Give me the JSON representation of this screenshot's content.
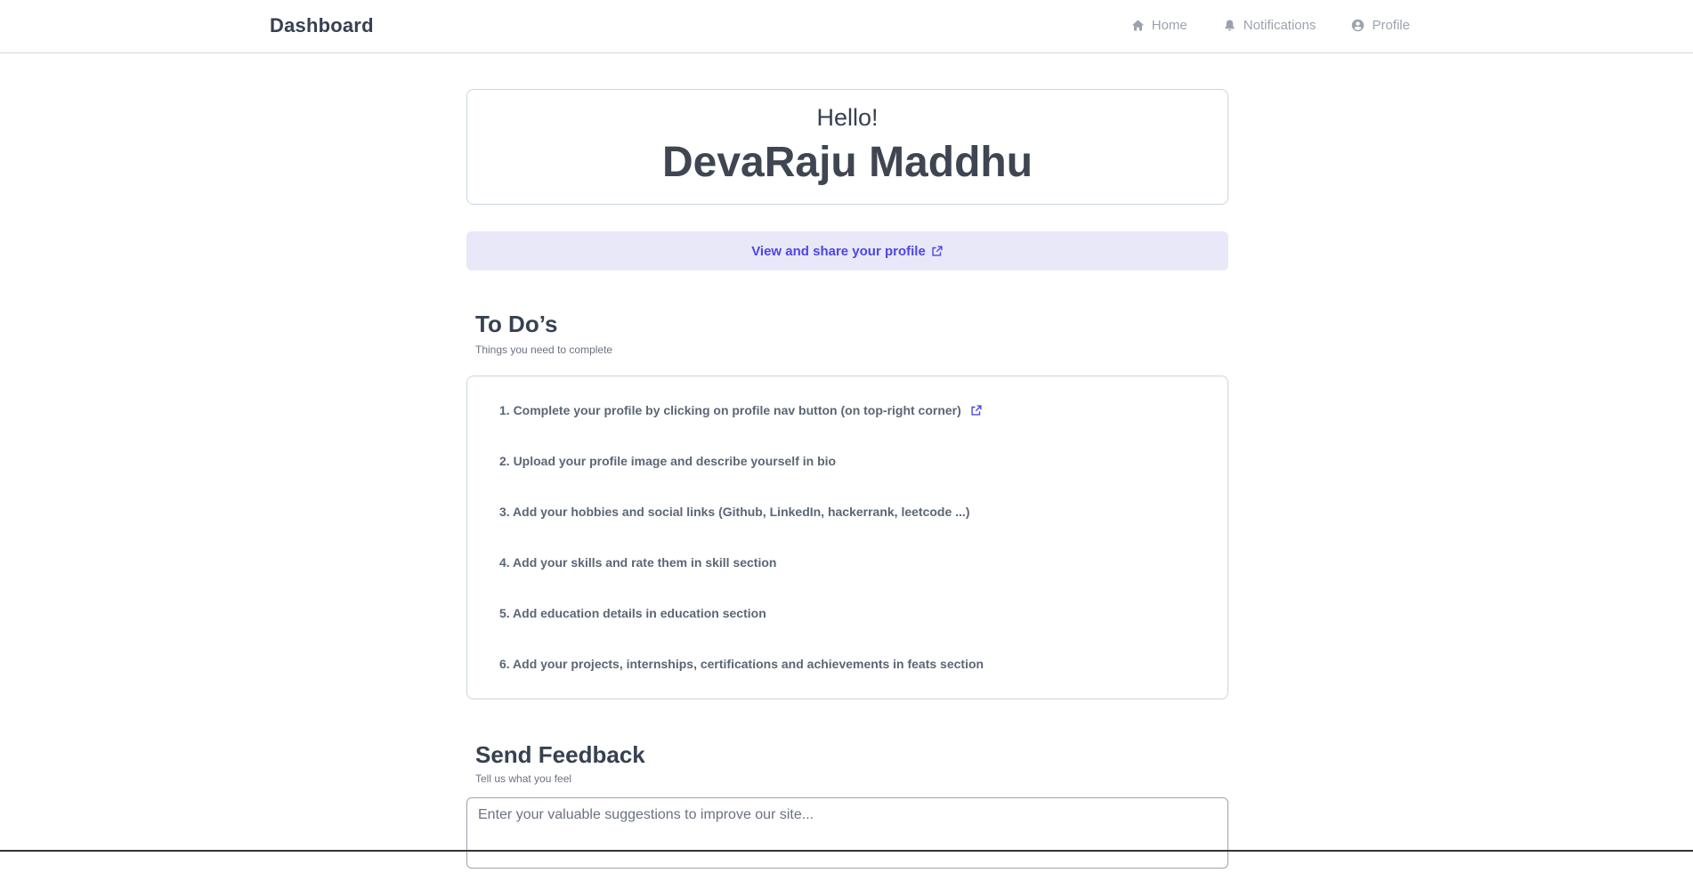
{
  "navbar": {
    "brand": "Dashboard",
    "links": [
      {
        "label": "Home",
        "icon": "home-icon"
      },
      {
        "label": "Notifications",
        "icon": "bell-icon"
      },
      {
        "label": "Profile",
        "icon": "user-circle-icon"
      }
    ]
  },
  "hello": {
    "greeting": "Hello!",
    "name": "DevaRaju Maddhu"
  },
  "share": {
    "label": "View and share your profile",
    "icon": "external-link-icon"
  },
  "todos": {
    "title": "To Do’s",
    "subtitle": "Things you need to complete",
    "items": [
      "1. Complete your profile by clicking on profile nav button (on top-right corner)",
      "2. Upload your profile image and describe yourself in bio",
      "3. Add your hobbies and social links (Github, LinkedIn, hackerrank, leetcode ...)",
      "4. Add your skills and rate them in skill section",
      "5. Add education details in education section",
      "6. Add your projects, internships, certifications and achievements in feats section"
    ]
  },
  "feedback": {
    "title": "Send Feedback",
    "subtitle": "Tell us what you feel",
    "placeholder": "Enter your valuable suggestions to improve our site..."
  },
  "colors": {
    "accent": "#4f46e5",
    "share_bg": "#e8e8f8",
    "text_dark": "#374151",
    "nav_muted": "#9ca3af"
  }
}
